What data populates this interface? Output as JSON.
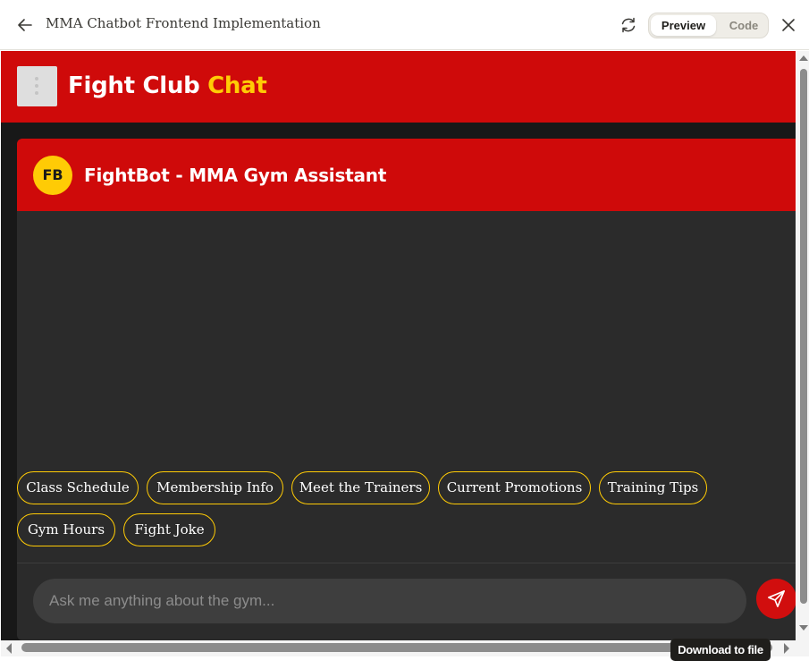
{
  "artifact": {
    "title": "MMA Chatbot Frontend Implementation",
    "toggle": {
      "preview_label": "Preview",
      "code_label": "Code",
      "selected": "Preview"
    },
    "icons": {
      "back": "arrow-left-icon",
      "refresh": "refresh-icon",
      "close": "close-icon"
    },
    "tooltip": "Download to file"
  },
  "app": {
    "brand_main": "Fight Club",
    "brand_accent": "Chat",
    "menu_icon": "vertical-dots-icon",
    "colors": {
      "primary": "#cf0a0a",
      "accent": "#ffcb05",
      "background": "#181818",
      "panel": "#2b2b2b"
    }
  },
  "chat": {
    "bot_initials": "FB",
    "bot_title": "FightBot - MMA Gym Assistant",
    "quick_replies": [
      "Class Schedule",
      "Membership Info",
      "Meet the Trainers",
      "Current Promotions",
      "Training Tips",
      "Gym Hours",
      "Fight Joke"
    ],
    "input_placeholder": "Ask me anything about the gym...",
    "send_icon": "send-icon"
  }
}
